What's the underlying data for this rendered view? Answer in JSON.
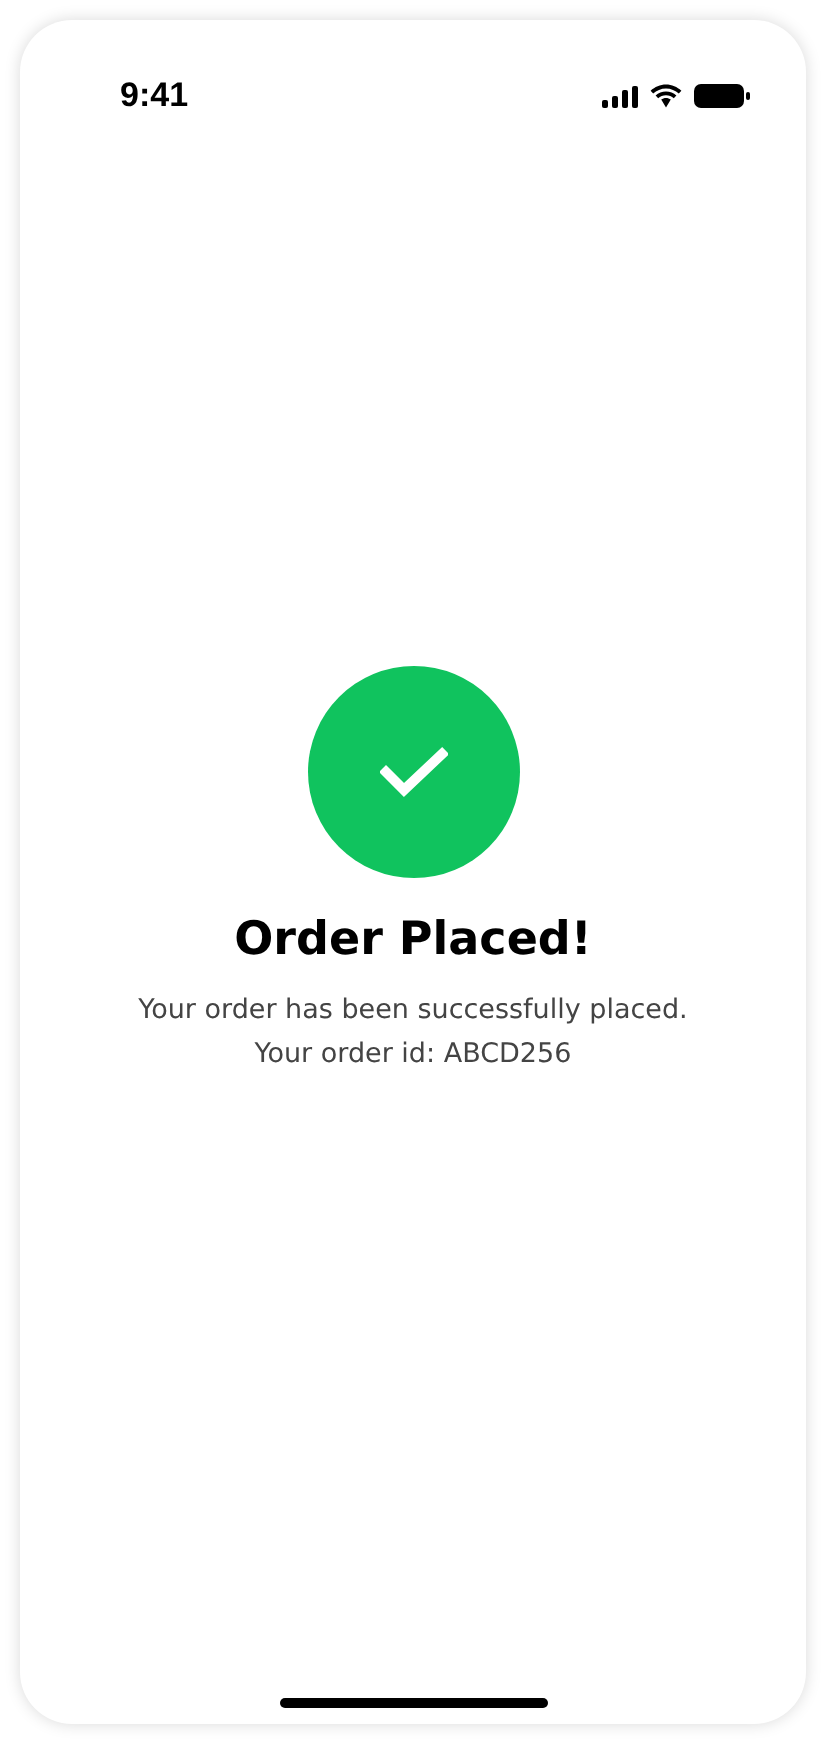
{
  "status_bar": {
    "time": "9:41"
  },
  "confirmation": {
    "title": "Order Placed!",
    "message": "Your order has been successfully placed.",
    "order_id_line": "Your order id: ABCD256"
  }
}
